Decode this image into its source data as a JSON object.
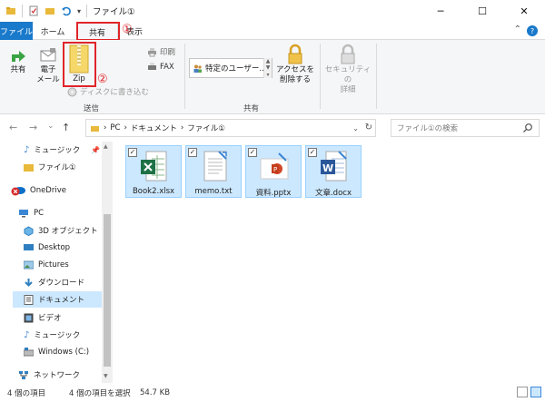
{
  "titlebar": {
    "title": "ファイル①",
    "minimize": "─",
    "maximize": "☐",
    "close": "✕"
  },
  "tabs": {
    "file": "ファイル",
    "home": "ホーム",
    "share": "共有",
    "view": "表示",
    "annotation_1": "①"
  },
  "ribbon": {
    "share_label": "共有",
    "email_label_1": "電子",
    "email_label_2": "メール",
    "zip_label": "Zip",
    "annotation_2": "②",
    "burn_label": "ディスクに書き込む",
    "print_label": "印刷",
    "fax_label": "FAX",
    "send_group": "送信",
    "share_with": "特定のユーザー...",
    "remove_access_1": "アクセスを",
    "remove_access_2": "削除する",
    "share_group": "共有",
    "security_1": "セキュリティの",
    "security_2": "詳細"
  },
  "address": {
    "back": "←",
    "forward": "→",
    "recent": "⌄",
    "up": "↑",
    "crumb_sep": "›",
    "crumb_pc": "PC",
    "crumb_docs": "ドキュメント",
    "crumb_folder": "ファイル①",
    "refresh": "↻",
    "search_placeholder": "ファイル①の検索"
  },
  "navpane": {
    "items": [
      {
        "label": "ミュージック"
      },
      {
        "label": "ファイル①"
      },
      {
        "label": "OneDrive"
      },
      {
        "label": "PC"
      },
      {
        "label": "3D オブジェクト"
      },
      {
        "label": "Desktop"
      },
      {
        "label": "Pictures"
      },
      {
        "label": "ダウンロード"
      },
      {
        "label": "ドキュメント"
      },
      {
        "label": "ビデオ"
      },
      {
        "label": "ミュージック"
      },
      {
        "label": "Windows (C:)"
      },
      {
        "label": "ネットワーク"
      }
    ]
  },
  "files": [
    {
      "name": "Book2.xlsx",
      "icon": "excel-icon",
      "checked": "✓"
    },
    {
      "name": "memo.txt",
      "icon": "text-file-icon",
      "checked": "✓"
    },
    {
      "name": "資料.pptx",
      "icon": "powerpoint-icon",
      "checked": "✓"
    },
    {
      "name": "文章.docx",
      "icon": "word-icon",
      "checked": "✓"
    }
  ],
  "status": {
    "item_count": "4 個の項目",
    "selected": "4 個の項目を選択",
    "size": "54.7 KB"
  },
  "colors": {
    "accent": "#1979ca",
    "selection": "#cce8ff",
    "annotation": "#e0252b"
  }
}
